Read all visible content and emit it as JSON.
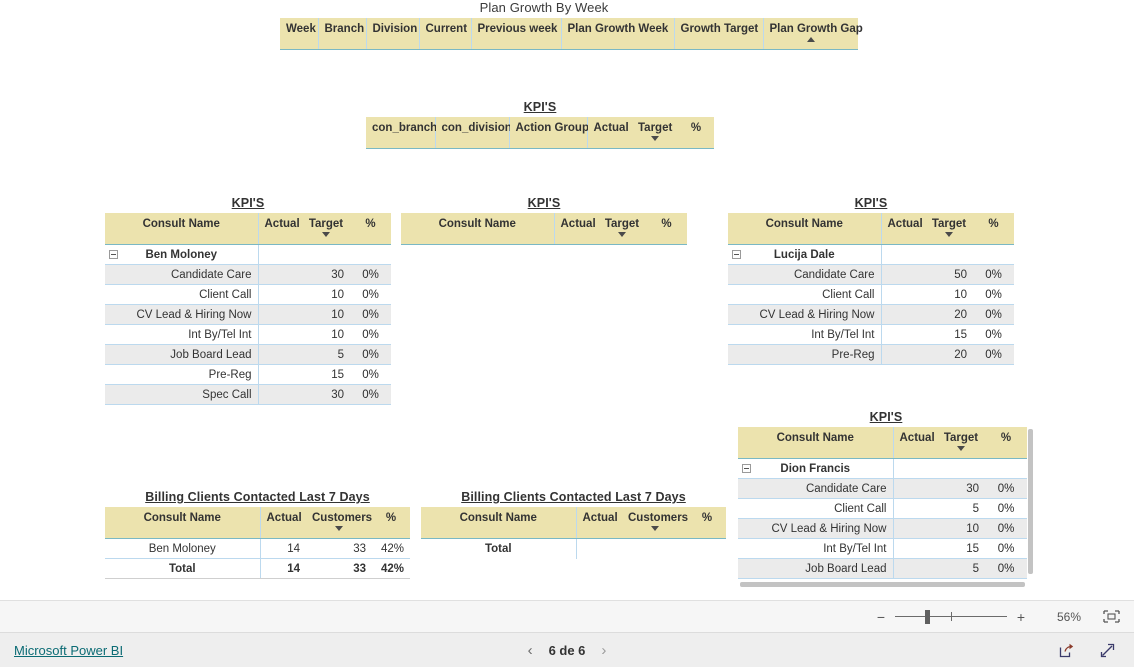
{
  "report": {
    "title": "Plan Growth By Week",
    "slicer_headers": [
      "Week",
      "Branch",
      "Division",
      "Current",
      "Previous week",
      "Plan Growth Week",
      "Growth Target",
      "Plan Growth Gap"
    ]
  },
  "kpi_top": {
    "title": "KPI'S",
    "columns": [
      "con_branch",
      "con_division",
      "Action Group",
      "Actual",
      "Target",
      "%"
    ],
    "sorted_column": "Target",
    "rows": []
  },
  "kpi_ben": {
    "title": "KPI'S",
    "columns": [
      "Consult Name",
      "Actual",
      "Target",
      "%"
    ],
    "sorted_column": "Target",
    "group": "Ben Moloney",
    "rows": [
      {
        "name": "Candidate Care",
        "actual": "",
        "target": "30",
        "pct": "0%"
      },
      {
        "name": "Client Call",
        "actual": "",
        "target": "10",
        "pct": "0%"
      },
      {
        "name": "CV Lead & Hiring Now",
        "actual": "",
        "target": "10",
        "pct": "0%"
      },
      {
        "name": "Int By/Tel Int",
        "actual": "",
        "target": "10",
        "pct": "0%"
      },
      {
        "name": "Job Board Lead",
        "actual": "",
        "target": "5",
        "pct": "0%"
      },
      {
        "name": "Pre-Reg",
        "actual": "",
        "target": "15",
        "pct": "0%"
      },
      {
        "name": "Spec Call",
        "actual": "",
        "target": "30",
        "pct": "0%"
      }
    ]
  },
  "kpi_empty": {
    "title": "KPI'S",
    "columns": [
      "Consult Name",
      "Actual",
      "Target",
      "%"
    ],
    "sorted_column": "Target",
    "rows": []
  },
  "kpi_lucija": {
    "title": "KPI'S",
    "columns": [
      "Consult Name",
      "Actual",
      "Target",
      "%"
    ],
    "sorted_column": "Target",
    "group": "Lucija Dale",
    "rows": [
      {
        "name": "Candidate Care",
        "actual": "",
        "target": "50",
        "pct": "0%"
      },
      {
        "name": "Client Call",
        "actual": "",
        "target": "10",
        "pct": "0%"
      },
      {
        "name": "CV Lead & Hiring Now",
        "actual": "",
        "target": "20",
        "pct": "0%"
      },
      {
        "name": "Int By/Tel Int",
        "actual": "",
        "target": "15",
        "pct": "0%"
      },
      {
        "name": "Pre-Reg",
        "actual": "",
        "target": "20",
        "pct": "0%"
      }
    ]
  },
  "kpi_dion": {
    "title": "KPI'S",
    "columns": [
      "Consult Name",
      "Actual",
      "Target",
      "%"
    ],
    "sorted_column": "Target",
    "group": "Dion Francis",
    "rows": [
      {
        "name": "Candidate Care",
        "actual": "",
        "target": "30",
        "pct": "0%"
      },
      {
        "name": "Client Call",
        "actual": "",
        "target": "5",
        "pct": "0%"
      },
      {
        "name": "CV Lead & Hiring Now",
        "actual": "",
        "target": "10",
        "pct": "0%"
      },
      {
        "name": "Int By/Tel Int",
        "actual": "",
        "target": "15",
        "pct": "0%"
      },
      {
        "name": "Job Board Lead",
        "actual": "",
        "target": "5",
        "pct": "0%"
      }
    ]
  },
  "billing_left": {
    "title": "Billing Clients Contacted Last 7 Days",
    "columns": [
      "Consult Name",
      "Actual",
      "Customers",
      "%"
    ],
    "sorted_column": "Customers",
    "rows": [
      {
        "name": "Ben Moloney",
        "actual": "14",
        "customers": "33",
        "pct": "42%"
      }
    ],
    "total": {
      "label": "Total",
      "actual": "14",
      "customers": "33",
      "pct": "42%"
    }
  },
  "billing_right": {
    "title": "Billing Clients Contacted Last 7 Days",
    "columns": [
      "Consult Name",
      "Actual",
      "Customers",
      "%"
    ],
    "sorted_column": "Customers",
    "rows": [],
    "total": {
      "label": "Total",
      "actual": "",
      "customers": "",
      "pct": ""
    }
  },
  "zoom_bar": {
    "minus": "−",
    "plus": "+",
    "percent": "56%",
    "fit_icon": "fit-to-page-icon"
  },
  "status_bar": {
    "brand": "Microsoft Power BI",
    "prev_icon": "chevron-left-icon",
    "next_icon": "chevron-right-icon",
    "page_label": "6 de 6",
    "share_icon": "share-icon",
    "fullscreen_icon": "fullscreen-icon"
  },
  "colors": {
    "header_yellow": "#ece3ae",
    "red_cell": "#da4a5a",
    "band_gray": "#ebebeb",
    "grid_blue": "#bcd9ee",
    "brand_teal": "#0b6b74"
  }
}
